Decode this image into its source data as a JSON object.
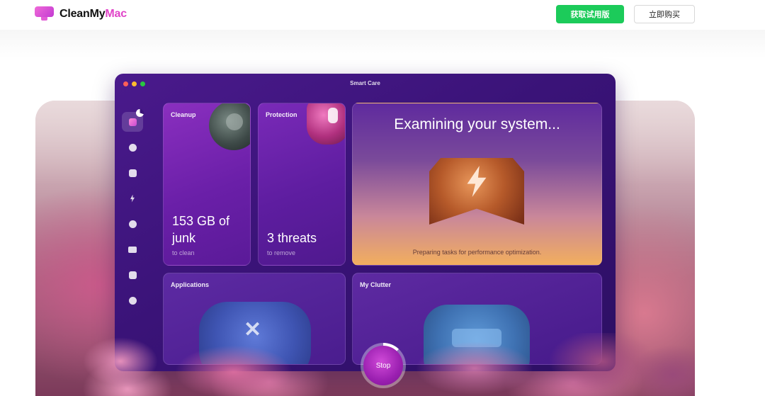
{
  "header": {
    "brand_prefix": "CleanMy",
    "brand_accent": "Mac",
    "trial_button": "获取试用版",
    "buy_button": "立即购买"
  },
  "colors": {
    "trial_green": "#1ccb5a",
    "brand_pink": "#e043c8",
    "window_purple": "#3a1378",
    "hero_orange": "#f2ae5e"
  },
  "window": {
    "title": "Smart Care"
  },
  "sidebar": {
    "items": [
      {
        "icon": "smart-care-icon",
        "active": true
      },
      {
        "icon": "cleanup-icon"
      },
      {
        "icon": "protection-icon"
      },
      {
        "icon": "performance-icon"
      },
      {
        "icon": "applications-icon"
      },
      {
        "icon": "my-clutter-icon"
      },
      {
        "icon": "space-lens-icon"
      },
      {
        "icon": "cloud-cleanup-icon"
      }
    ]
  },
  "cards": {
    "cleanup": {
      "label": "Cleanup",
      "value": "153 GB of junk",
      "sub": "to clean"
    },
    "protection": {
      "label": "Protection",
      "value": "3 threats",
      "sub": "to remove"
    },
    "performance": {
      "title": "Examining your system...",
      "status": "Preparing tasks for performance optimization."
    },
    "applications": {
      "label": "Applications"
    },
    "clutter": {
      "label": "My Clutter"
    }
  },
  "actions": {
    "stop": "Stop"
  }
}
